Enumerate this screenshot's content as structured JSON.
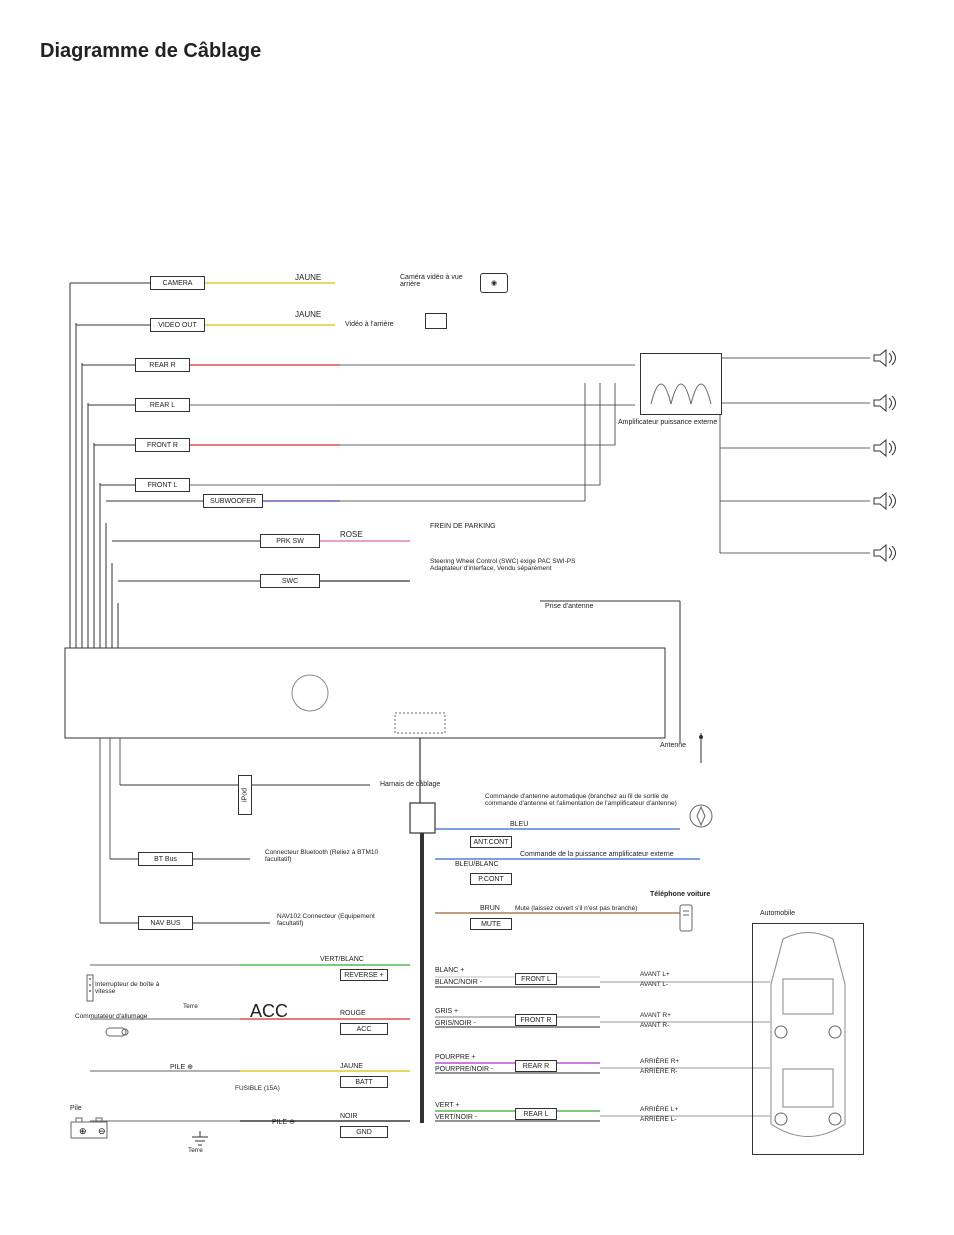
{
  "title": "Diagramme de Câblage",
  "top_connectors": {
    "camera": "CAMERA",
    "video_out": "VIDEO OUT",
    "rear_r": "REAR R",
    "rear_l": "REAR L",
    "front_r": "FRONT R",
    "front_l": "FRONT L",
    "subwoofer": "SUBWOOFER",
    "prk_sw": "PRK SW",
    "swc": "SWC"
  },
  "top_labels": {
    "jaune1": "JAUNE",
    "jaune2": "JAUNE",
    "camera_desc": "Caméra vidéo à vue arrière",
    "video_desc": "Vidéo à l'arrière",
    "rose": "ROSE",
    "parking": "FREIN DE PARKING",
    "swc_desc": "Steering Wheel Control (SWC) exige PAC SWI-PS Adaptateur d'interface, Vendu séparément",
    "antenna_in": "Prise d'antenne",
    "amp_label": "Amplificateur puissance externe"
  },
  "mid": {
    "ipod": "iPod",
    "harness": "Harnais de câblage",
    "bt_bus": "BT Bus",
    "bt_desc": "Connecteur Bluetooth (Reliez à BTM10 facultatif)",
    "nav_bus": "NAV BUS",
    "nav_desc": "NAV102 Connecteur (Equipement facultatif)",
    "antenna": "Antenne",
    "auto_antenna": "Commande d'antenne automatique (branchez au fil de sortie de commande d'antenne et l'alimentation de l'amplificateur d'antenne)",
    "amp_remote": "Commande de la puissance amplificateur externe",
    "phone": "Téléphone voiture",
    "mute_desc": "Mute (laissez ouvert s'il n'est pas branché)",
    "automobile": "Automobile"
  },
  "wire_colors": {
    "bleu": "BLEU",
    "ant_cont": "ANT.CONT",
    "bleu_blanc": "BLEU/BLANC",
    "p_cont": "P.CONT",
    "brun": "BRUN",
    "mute": "MUTE",
    "vert_blanc": "VERT/BLANC",
    "reverse": "REVERSE +",
    "rouge": "ROUGE",
    "acc_box": "ACC",
    "jaune": "JAUNE",
    "batt": "BATT",
    "noir": "NOIR",
    "gnd": "GND"
  },
  "speaker_wires": {
    "blanc_p": "BLANC +",
    "blanc_n": "BLANC/NOIR -",
    "gris_p": "GRIS +",
    "gris_n": "GRIS/NOIR -",
    "pourpre_p": "POURPRE +",
    "pourpre_n": "POURPRE/NOIR -",
    "vert_p": "VERT +",
    "vert_n": "VERT/NOIR -",
    "front_l": "FRONT L",
    "front_r": "FRONT R",
    "rear_r": "REAR R",
    "rear_l": "REAR L",
    "avant_lp": "AVANT L+",
    "avant_lm": "AVANT L-",
    "avant_rp": "AVANT R+",
    "avant_rm": "AVANT R-",
    "arriere_rp": "ARRIÈRE R+",
    "arriere_rm": "ARRIÈRE R-",
    "arriere_lp": "ARRIÈRE L+",
    "arriere_lm": "ARRIÈRE L-"
  },
  "bottom": {
    "gearbox": "Interrupteur de boîte à vitesse",
    "terre1": "Terre",
    "ignition": "Commutateur d'allumage",
    "acc_big": "ACC",
    "pile_plus": "PILE ⊕",
    "fuse": "FUSIBLE (15A)",
    "pile": "Pile",
    "pile_minus": "PILE ⊖",
    "terre2": "Terre"
  }
}
